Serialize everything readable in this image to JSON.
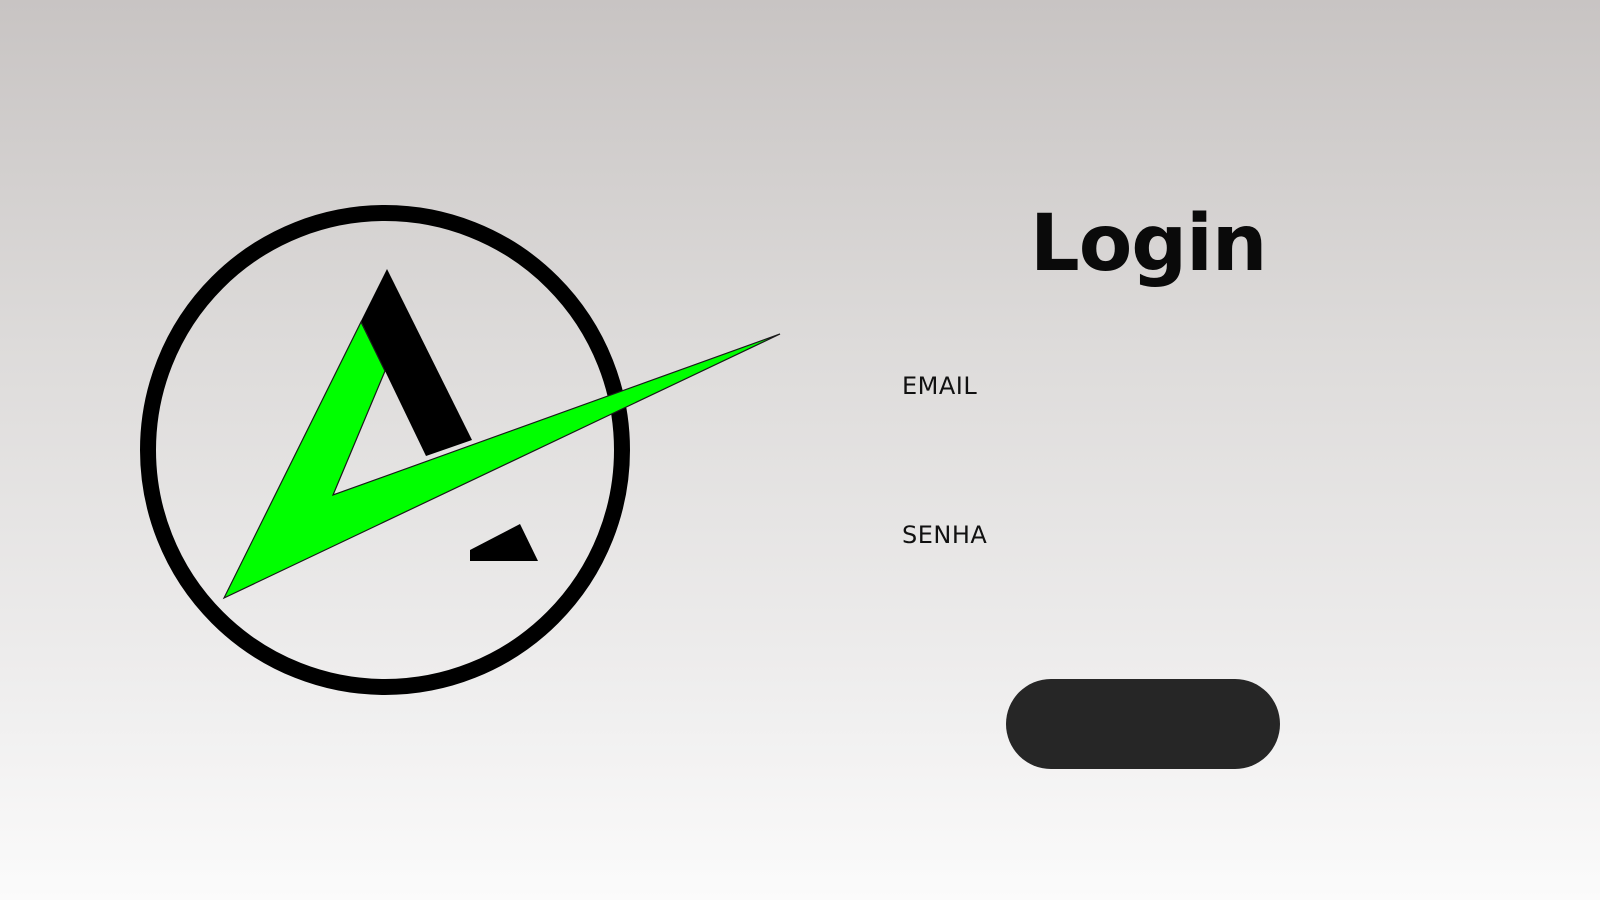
{
  "login": {
    "title": "Login",
    "email_label": "EMAIL",
    "email_value": "",
    "password_label": "SENHA",
    "password_value": "",
    "submit_label": ""
  },
  "colors": {
    "accent_green": "#00ff00",
    "logo_black": "#000000",
    "button": "#262626"
  },
  "icons": {
    "logo": "circle-letter-a-checkmark-logo"
  }
}
